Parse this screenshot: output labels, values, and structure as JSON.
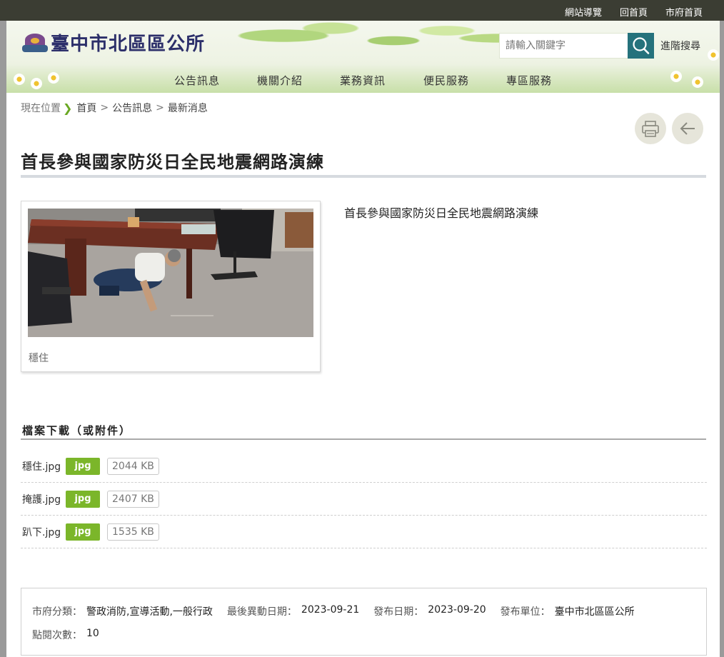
{
  "topbar": {
    "links": [
      "網站導覽",
      "回首頁",
      "市府首頁"
    ]
  },
  "header": {
    "site_title": "臺中市北區區公所",
    "search": {
      "placeholder": "請輸入關鍵字",
      "value": ""
    },
    "advanced_search": "進階搜尋"
  },
  "nav": {
    "items": [
      "公告訊息",
      "機關介紹",
      "業務資訊",
      "便民服務",
      "專區服務"
    ]
  },
  "breadcrumb": {
    "label": "現在位置",
    "items": [
      "首頁",
      "公告訊息",
      "最新消息"
    ],
    "separator": ">"
  },
  "toolbar": {
    "print_icon": "printer-icon",
    "back_icon": "arrow-left-icon"
  },
  "article": {
    "title": "首長參與國家防災日全民地震網路演練",
    "description": "首長參與國家防災日全民地震網路演練",
    "photo_caption": "穩住"
  },
  "attachments": {
    "title": "檔案下載（或附件）",
    "files": [
      {
        "name": "穩住.jpg",
        "type": "jpg",
        "size": "2044 KB"
      },
      {
        "name": "掩護.jpg",
        "type": "jpg",
        "size": "2407 KB"
      },
      {
        "name": "趴下.jpg",
        "type": "jpg",
        "size": "1535 KB"
      }
    ]
  },
  "meta": {
    "category_label": "市府分類：",
    "category": "警政消防,宣導活動,一般行政",
    "modified_label": "最後異動日期：",
    "modified": "2023-09-21",
    "published_label": "發布日期：",
    "published": "2023-09-20",
    "unit_label": "發布單位：",
    "unit": "臺中市北區區公所",
    "views_label": "點閱次數：",
    "views": "10"
  },
  "colors": {
    "topbar": "#3b3d33",
    "search_button": "#25727c",
    "file_badge": "#7bb62a",
    "breadcrumb_chevron": "#6aa823"
  }
}
